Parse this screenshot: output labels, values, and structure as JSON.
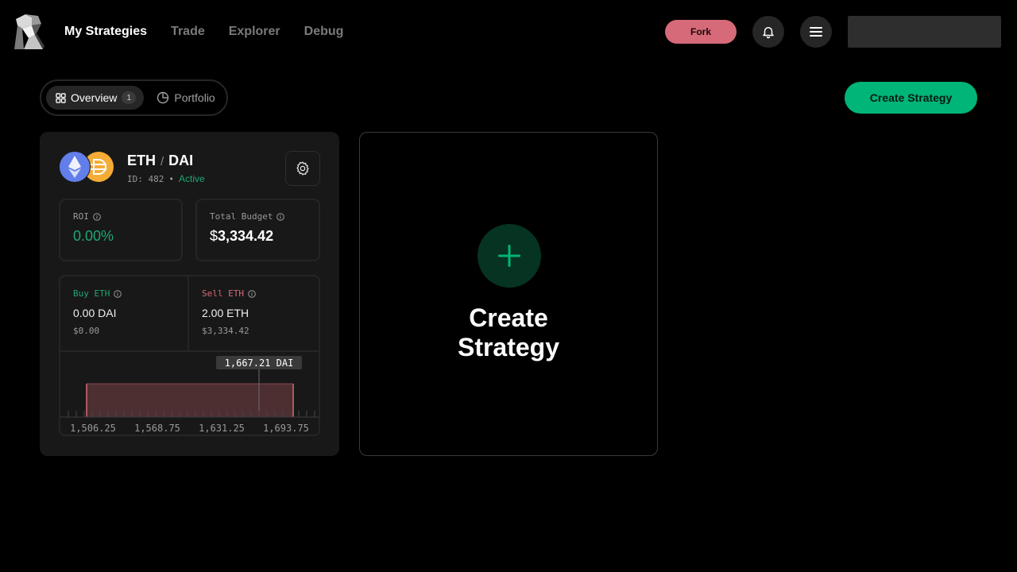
{
  "nav": {
    "items": [
      {
        "label": "My Strategies",
        "active": true
      },
      {
        "label": "Trade",
        "active": false
      },
      {
        "label": "Explorer",
        "active": false
      },
      {
        "label": "Debug",
        "active": false
      }
    ],
    "fork_label": "Fork",
    "bell_icon": "bell-icon",
    "menu_icon": "hamburger-menu-icon"
  },
  "tabs": {
    "overview_label": "Overview",
    "overview_count": "1",
    "portfolio_label": "Portfolio"
  },
  "create_button_label": "Create Strategy",
  "strategy": {
    "base": "ETH",
    "separator": "/",
    "quote": "DAI",
    "id_text": "ID: 482",
    "bullet": "•",
    "status": "Active",
    "roi_label": "ROI",
    "roi_value": "0.00%",
    "budget_label": "Total Budget",
    "budget_symbol": "$",
    "budget_value": "3,334.42",
    "buy_label": "Buy ETH",
    "buy_amount": "0.00 DAI",
    "buy_fiat": "$0.00",
    "sell_label": "Sell ETH",
    "sell_amount": "2.00 ETH",
    "sell_fiat": "$3,334.42",
    "chart": {
      "price_tag": "1,667.21 DAI",
      "ticks": [
        "1,506.25",
        "1,568.75",
        "1,631.25",
        "1,693.75"
      ]
    }
  },
  "create_tile": {
    "title_line1": "Create",
    "title_line2": "Strategy"
  },
  "colors": {
    "accent_green": "#00b578",
    "sell_red": "#d66a78",
    "buy_green": "#1ea672"
  }
}
